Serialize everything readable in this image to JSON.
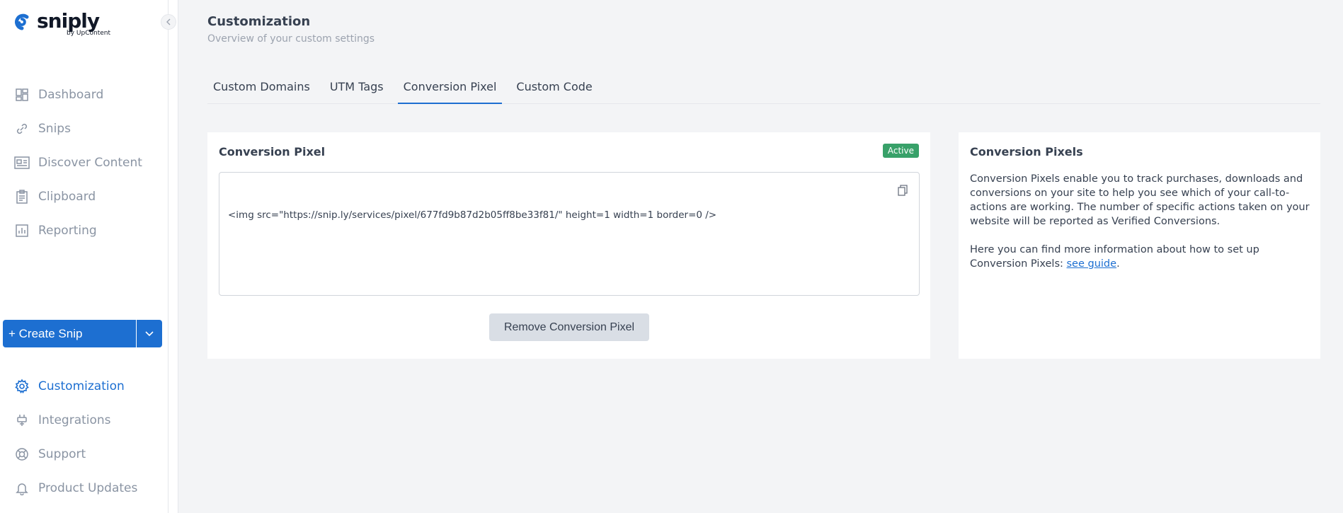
{
  "brand": {
    "name": "sniply",
    "byline": "by UpContent",
    "accent": "#1d6fd1"
  },
  "sidebar": {
    "nav_top": [
      {
        "label": "Dashboard",
        "icon": "dashboard-icon"
      },
      {
        "label": "Snips",
        "icon": "snips-icon"
      },
      {
        "label": "Discover Content",
        "icon": "discover-icon"
      },
      {
        "label": "Clipboard",
        "icon": "clipboard-icon"
      },
      {
        "label": "Reporting",
        "icon": "reporting-icon"
      }
    ],
    "create_label": "+ Create Snip",
    "nav_bottom": [
      {
        "label": "Customization",
        "icon": "gear-icon",
        "active": true
      },
      {
        "label": "Integrations",
        "icon": "plug-icon"
      },
      {
        "label": "Support",
        "icon": "lifebuoy-icon"
      },
      {
        "label": "Product Updates",
        "icon": "bell-icon"
      }
    ]
  },
  "header": {
    "title": "Customization",
    "subtitle": "Overview of your custom settings"
  },
  "tabs": [
    {
      "label": "Custom Domains"
    },
    {
      "label": "UTM Tags"
    },
    {
      "label": "Conversion Pixel",
      "active": true
    },
    {
      "label": "Custom Code"
    }
  ],
  "pixel_card": {
    "title": "Conversion Pixel",
    "status": "Active",
    "status_color": "#38a169",
    "code": "<img src=\"https://snip.ly/services/pixel/677fd9b87d2b05ff8be33f81/\" height=1 width=1 border=0 />",
    "remove_label": "Remove Conversion Pixel"
  },
  "info_card": {
    "title": "Conversion Pixels",
    "paragraph1": "Conversion Pixels enable you to track purchases, downloads and conversions on your site to help you see which of your call-to-actions are working. The number of specific actions taken on your website will be reported as Verified Conversions.",
    "paragraph2_prefix": "Here you can find more information about how to set up Conversion Pixels: ",
    "link_label": "see guide",
    "paragraph2_suffix": "."
  }
}
